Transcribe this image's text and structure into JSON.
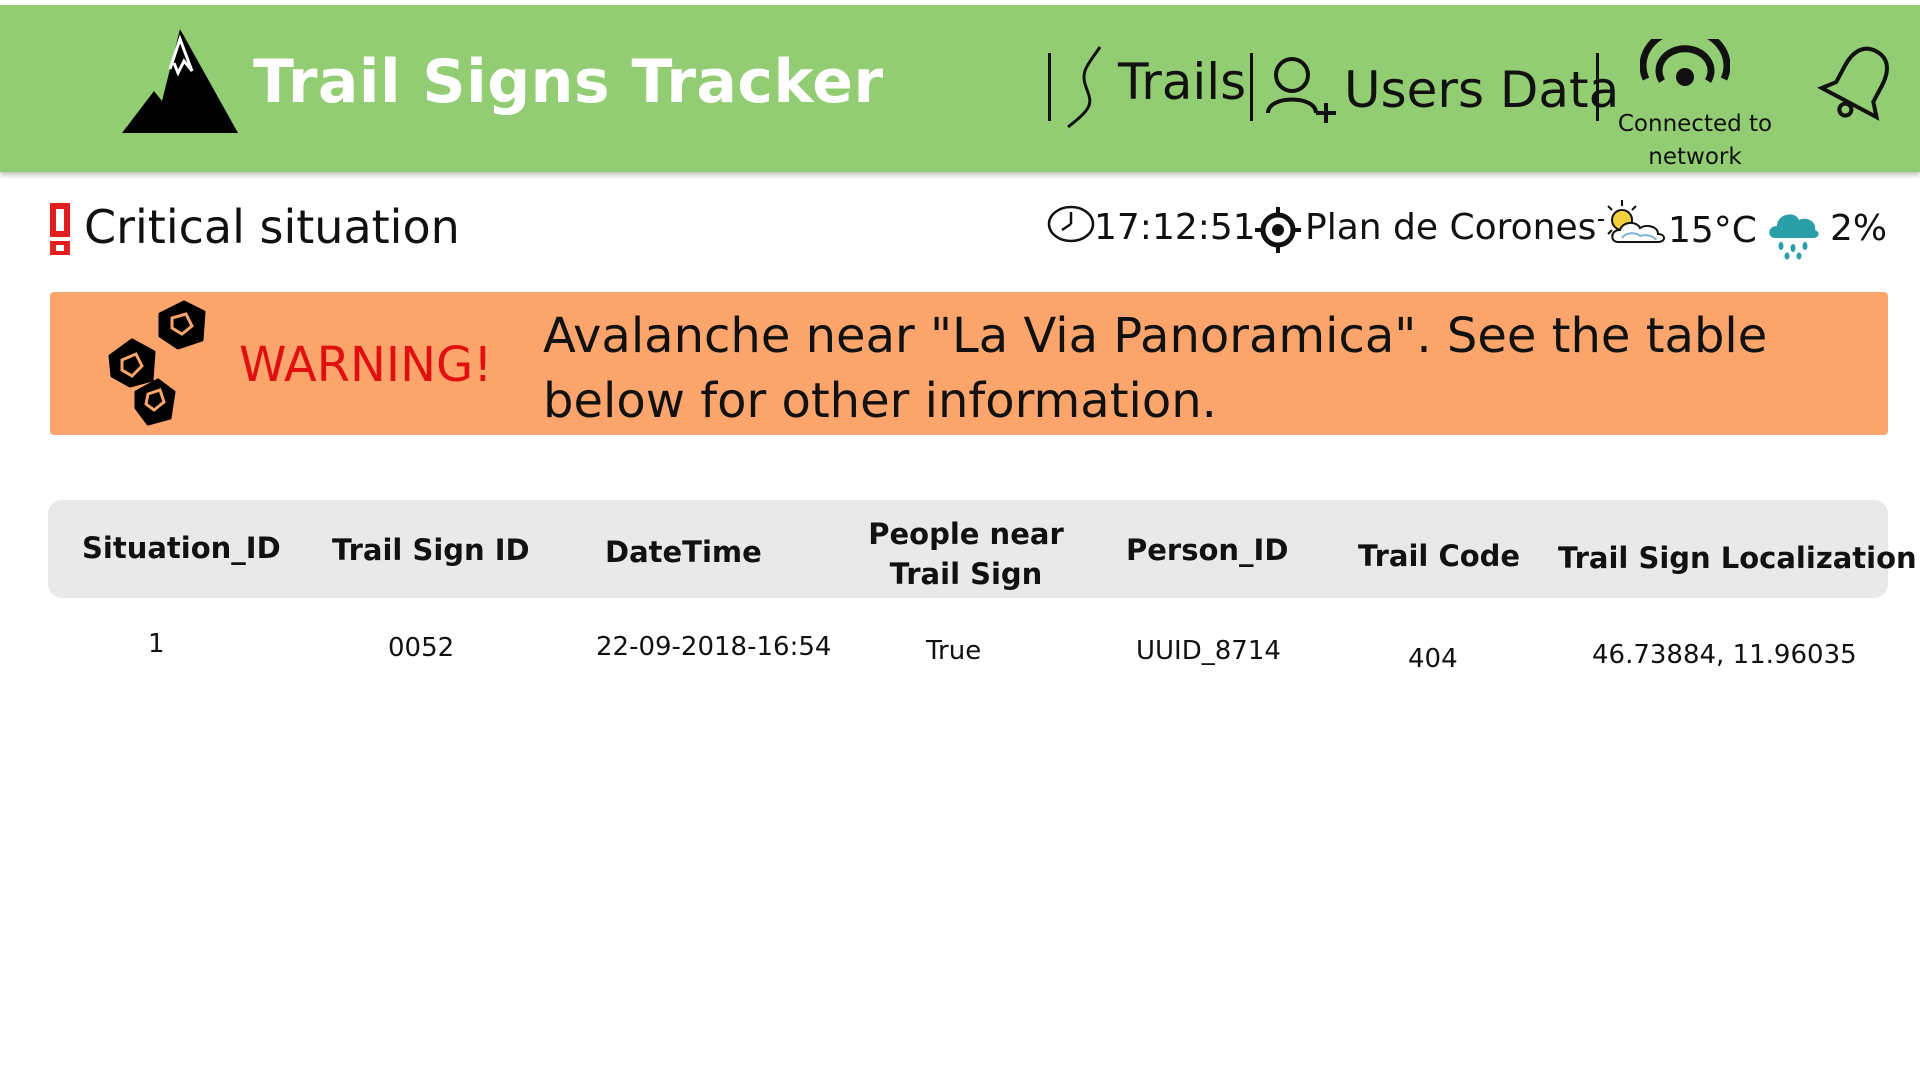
{
  "header": {
    "title": "Trail Signs Tracker",
    "nav": {
      "trails_label": "Trails",
      "users_label": "Users Data"
    },
    "network_status": "Connected to network",
    "background_color": "#93cd73"
  },
  "status_bar": {
    "situation_label": "Critical situation",
    "time": "17:12:51",
    "location": "Plan de Corones",
    "temperature": "15°C",
    "precipitation": "2%"
  },
  "warning": {
    "label": "WARNING!",
    "message": "Avalanche near \"La Via Panoramica\". See the table below for other information.",
    "background_color": "#fba56c",
    "label_color": "#e01010"
  },
  "table": {
    "columns": [
      "Situation_ID",
      "Trail Sign ID",
      "DateTime",
      "People near Trail Sign",
      "Person_ID",
      "Trail Code",
      "Trail Sign Localization"
    ],
    "rows": [
      [
        "1",
        "0052",
        "22-09-2018-16:54",
        "True",
        "UUID_8714",
        "404",
        "46.73884, 11.96035"
      ]
    ]
  },
  "icons": {
    "logo": "mountain-icon",
    "trails": "trail-path-icon",
    "users": "add-user-icon",
    "network": "wifi-icon",
    "notifications": "bell-icon",
    "critical": "exclamation-icon",
    "clock": "clock-icon",
    "location": "location-target-icon",
    "weather": "partly-sunny-icon",
    "rain": "rain-cloud-icon",
    "avalanche": "rocks-icon"
  }
}
